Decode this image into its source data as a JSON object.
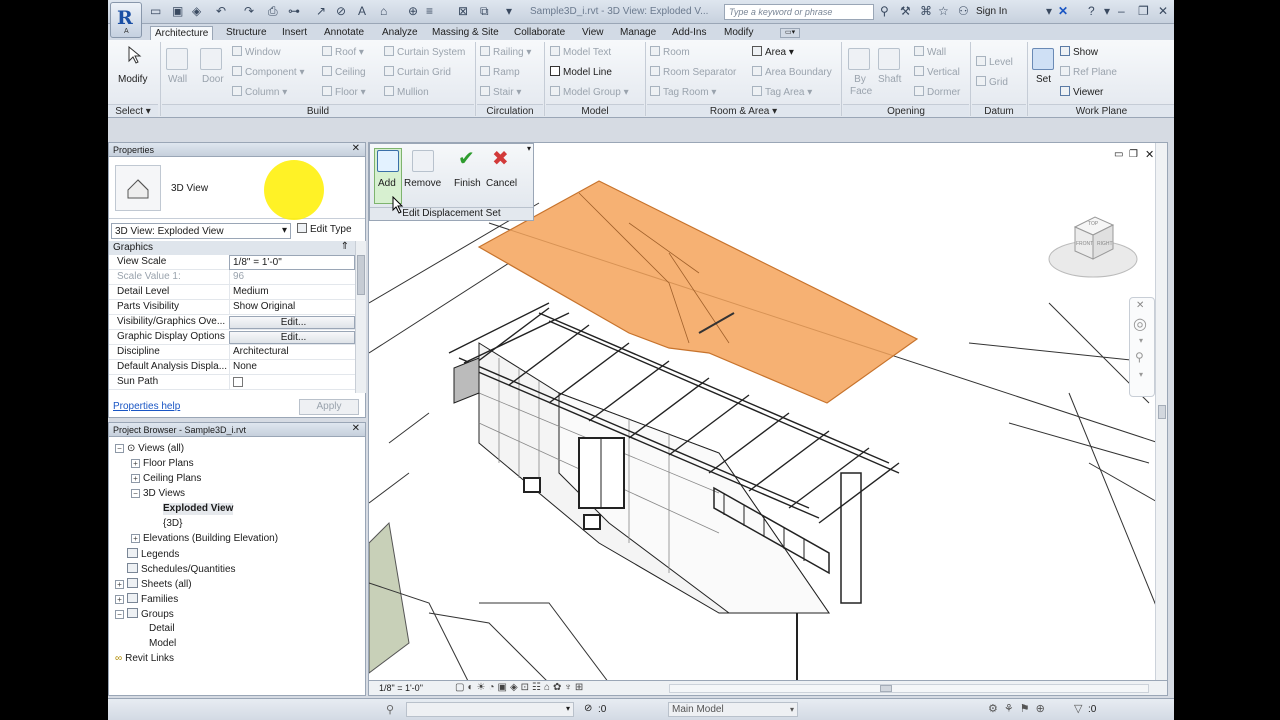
{
  "app": {
    "logo_letter": "R",
    "logo_sub": "A",
    "window_title": "Sample3D_i.rvt - 3D View: Exploded V..."
  },
  "search": {
    "placeholder": "Type a keyword or phrase"
  },
  "signin": {
    "label": "Sign In"
  },
  "tabs": [
    "Architecture",
    "Structure",
    "Insert",
    "Annotate",
    "Analyze",
    "Massing & Site",
    "Collaborate",
    "View",
    "Manage",
    "Add-Ins",
    "Modify"
  ],
  "ribbon": {
    "modify": "Modify",
    "select": "Select ▾",
    "build": {
      "wall": "Wall",
      "door": "Door",
      "window": "Window",
      "component": "Component",
      "column": "Column",
      "roof": "Roof",
      "ceiling": "Ceiling",
      "floor": "Floor",
      "curtain_system": "Curtain System",
      "curtain_grid": "Curtain Grid",
      "mullion": "Mullion",
      "label": "Build"
    },
    "circulation": {
      "railing": "Railing",
      "ramp": "Ramp",
      "stair": "Stair",
      "label": "Circulation"
    },
    "model": {
      "model_text": "Model Text",
      "model_line": "Model Line",
      "model_group": "Model Group",
      "label": "Model"
    },
    "room": {
      "room": "Room",
      "room_separator": "Room Separator",
      "tag_room": "Tag Room",
      "area": "Area",
      "area_boundary": "Area Boundary",
      "tag_area": "Tag Area",
      "label": "Room & Area ▾"
    },
    "opening": {
      "by_face": "By Face",
      "shaft": "Shaft",
      "wall": "Wall",
      "vertical": "Vertical",
      "dormer": "Dormer",
      "label": "Opening"
    },
    "datum": {
      "level": "Level",
      "grid": "Grid",
      "label": "Datum"
    },
    "workplane": {
      "set": "Set",
      "show": "Show",
      "ref_plane": "Ref Plane",
      "viewer": "Viewer",
      "label": "Work Plane"
    }
  },
  "properties": {
    "title": "Properties",
    "type_name": "3D View",
    "view_dropdown": "3D View: Exploded View",
    "edit_type": "Edit Type",
    "group": "Graphics",
    "rows": [
      {
        "k": "View Scale",
        "v": "1/8\" = 1'-0\""
      },
      {
        "k": "Scale Value    1:",
        "v": "96"
      },
      {
        "k": "Detail Level",
        "v": "Medium"
      },
      {
        "k": "Parts Visibility",
        "v": "Show Original"
      },
      {
        "k": "Visibility/Graphics Ove...",
        "v": "Edit..."
      },
      {
        "k": "Graphic Display Options",
        "v": "Edit..."
      },
      {
        "k": "Discipline",
        "v": "Architectural"
      },
      {
        "k": "Default Analysis Displa...",
        "v": "None"
      },
      {
        "k": "Sun Path",
        "v": ""
      }
    ],
    "help": "Properties help",
    "apply": "Apply"
  },
  "browser": {
    "title": "Project Browser - Sample3D_i.rvt",
    "items": [
      "Views (all)",
      "Floor Plans",
      "Ceiling Plans",
      "3D Views",
      "Exploded View",
      "{3D}",
      "Elevations (Building Elevation)",
      "Legends",
      "Schedules/Quantities",
      "Sheets (all)",
      "Families",
      "Groups",
      "Detail",
      "Model",
      "Revit Links"
    ]
  },
  "context_panel": {
    "add": "Add",
    "remove": "Remove",
    "finish": "Finish",
    "cancel": "Cancel",
    "label": "Edit Displacement Set"
  },
  "viewcube": {
    "top": "TOP",
    "front": "FRONT",
    "right": "RIGHT"
  },
  "canvas_status": {
    "scale": "1/8\" = 1'-0\""
  },
  "statusbar": {
    "zero1": ":0",
    "model": "Main Model",
    "zero2": ":0"
  },
  "colors": {
    "displaced_roof": "#f5a35a",
    "ribbon_bg": "#f0f3f7",
    "accent_blue": "#1a56c4"
  }
}
